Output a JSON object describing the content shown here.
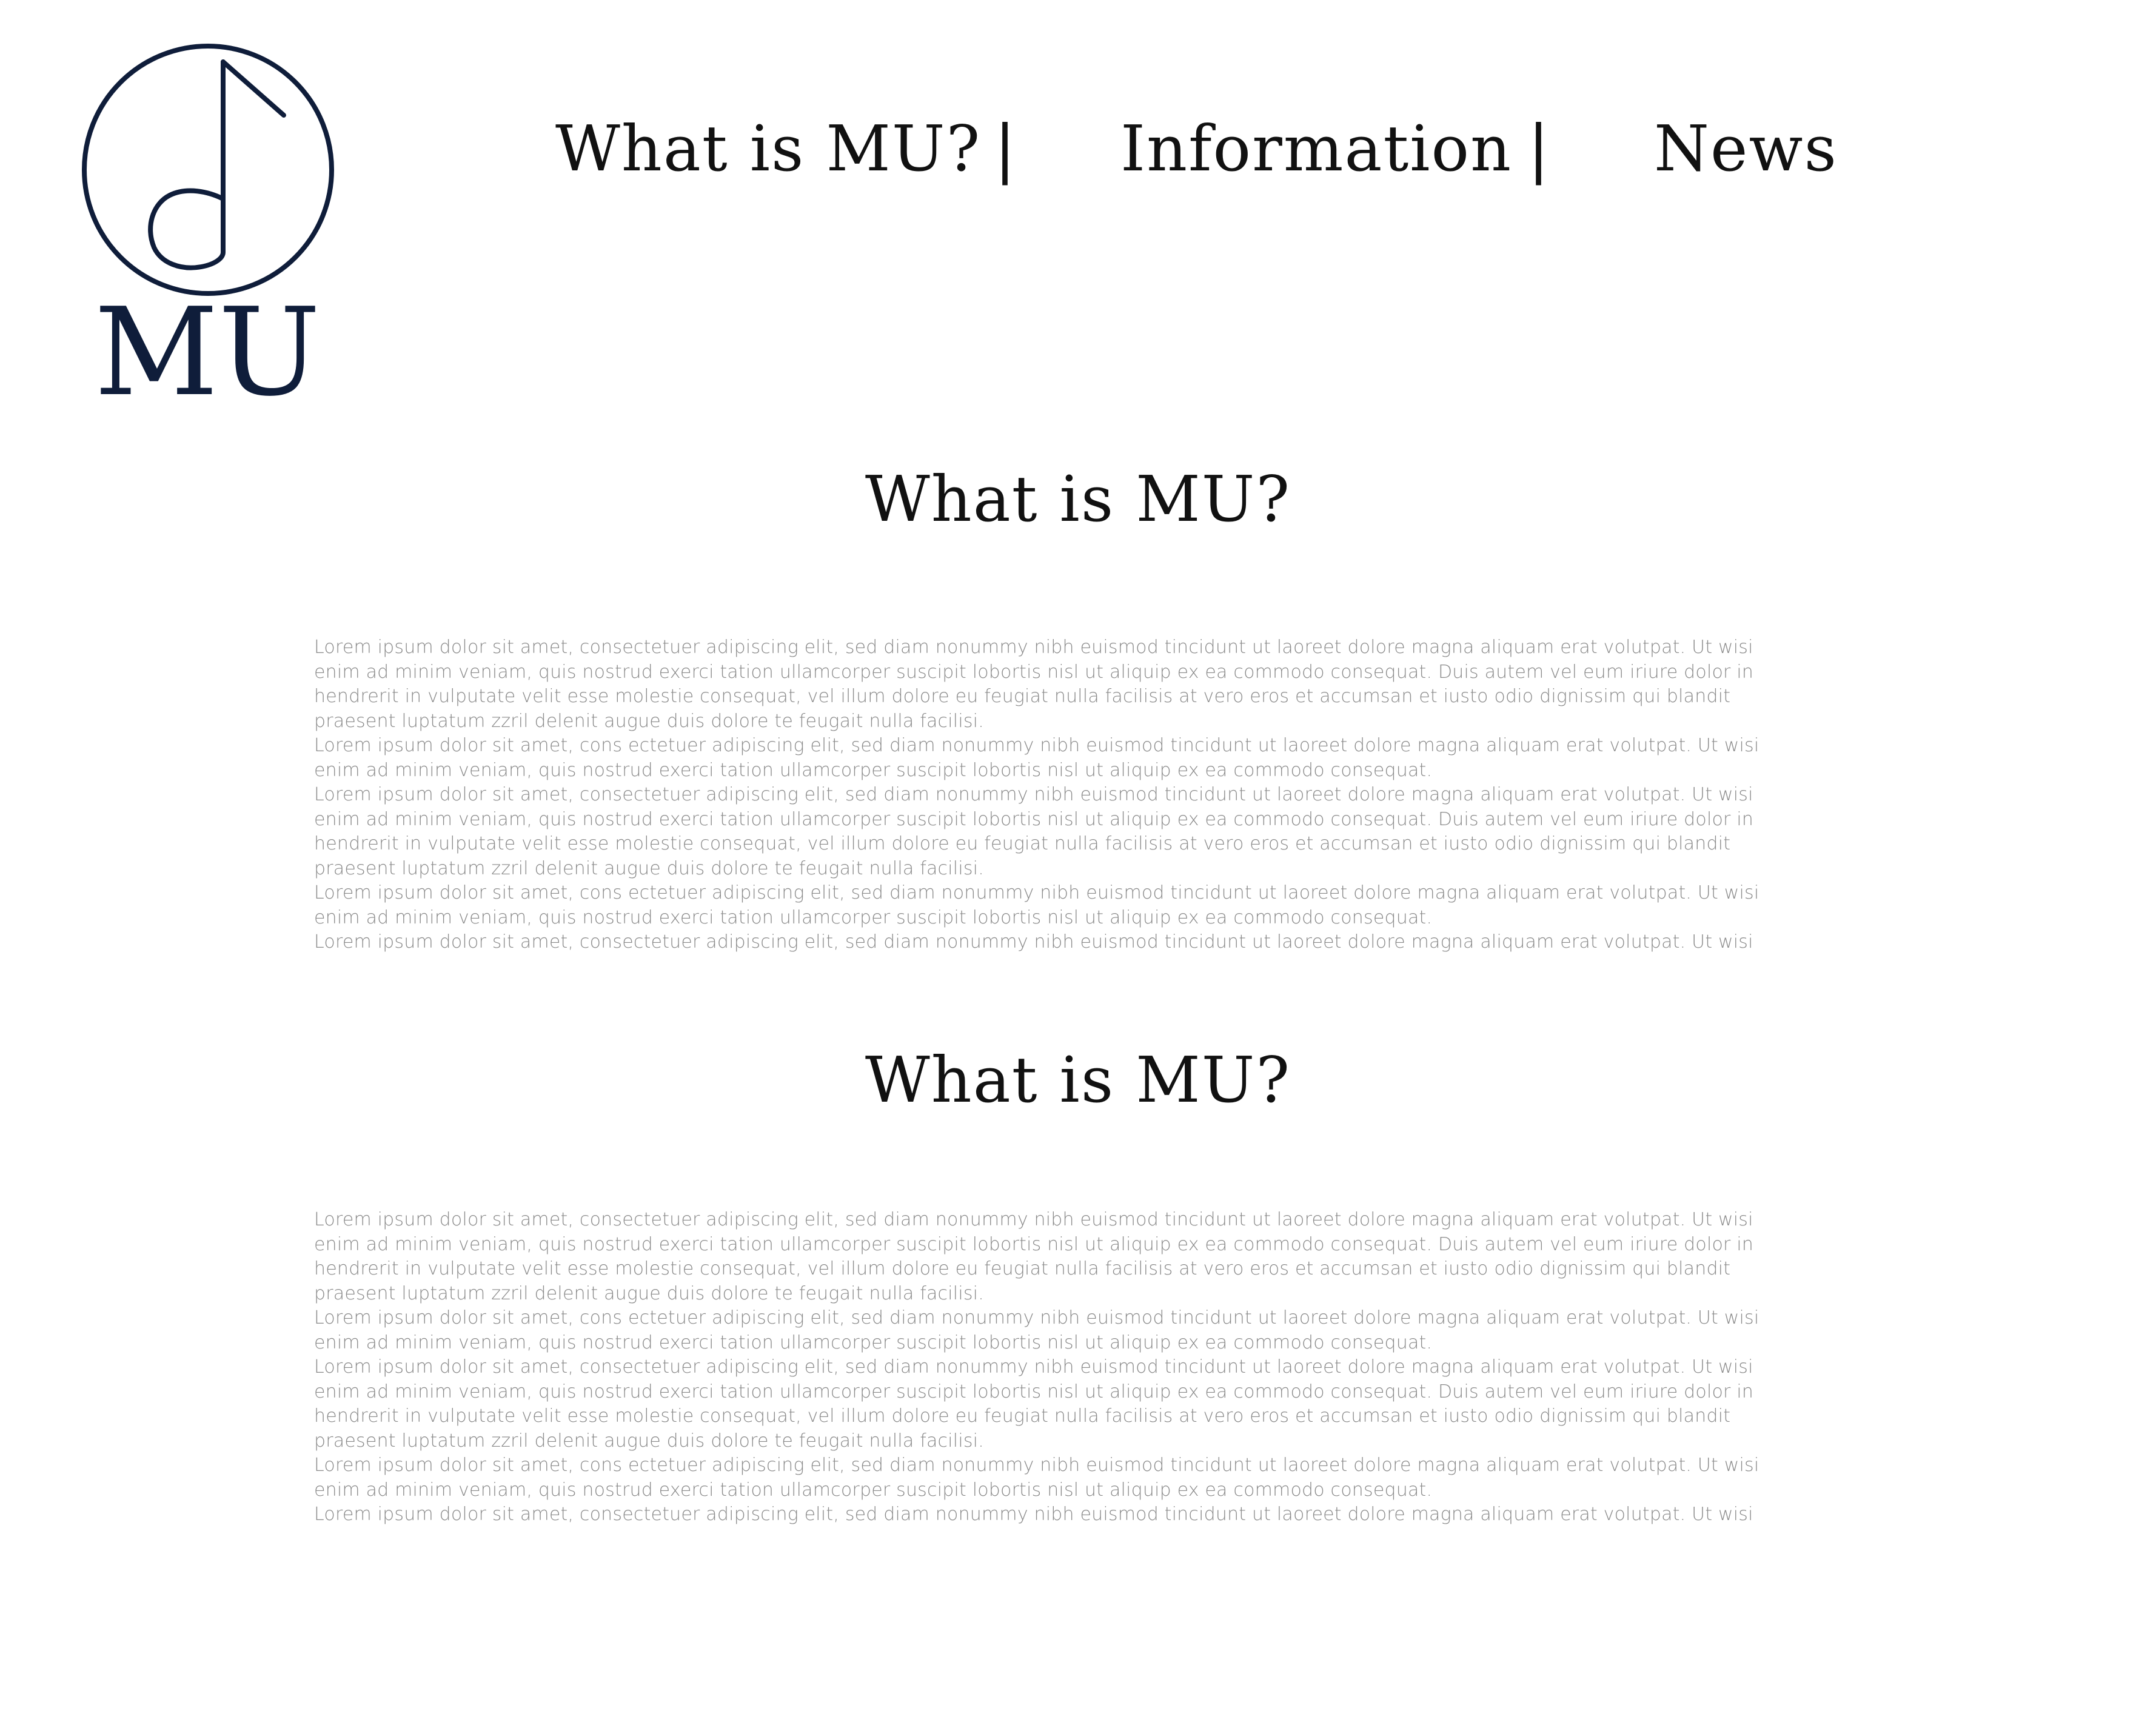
{
  "brand": {
    "logo_text": "MU",
    "logo_icon": "music-note-in-circle-icon",
    "color": "#0f1d3a"
  },
  "nav": {
    "items": [
      {
        "label": "What is MU?"
      },
      {
        "label": "Information"
      },
      {
        "label": "News"
      }
    ],
    "separator": "|"
  },
  "sections": [
    {
      "title": "What is MU?",
      "paragraphs": [
        "Lorem ipsum dolor sit amet, consectetuer adipiscing elit, sed diam nonummy nibh euismod tincidunt ut laoreet dolore magna aliquam erat volutpat. Ut wisi enim ad minim veniam, quis nostrud exerci tation ullamcorper suscipit lobortis nisl ut aliquip ex ea commodo consequat. Duis autem vel eum iriure dolor in hendrerit in vulputate velit esse molestie consequat, vel illum dolore eu feugiat nulla facilisis at vero eros et accumsan et iusto odio dignissim qui blandit praesent luptatum zzril delenit augue duis dolore te feugait nulla facilisi.",
        "Lorem ipsum dolor sit amet, cons ectetuer adipiscing elit, sed diam nonummy nibh euismod tincidunt ut laoreet dolore magna aliquam erat volutpat. Ut wisi enim ad minim veniam, quis nostrud exerci tation ullamcorper suscipit lobortis nisl ut aliquip ex ea commodo consequat.",
        "Lorem ipsum dolor sit amet, consectetuer adipiscing elit, sed diam nonummy nibh euismod tincidunt ut laoreet dolore magna aliquam erat volutpat. Ut wisi enim ad minim veniam, quis nostrud exerci tation ullamcorper suscipit lobortis nisl ut aliquip ex ea commodo consequat. Duis autem vel eum iriure dolor in hendrerit in vulputate velit esse molestie consequat, vel illum dolore eu feugiat nulla facilisis at vero eros et accumsan et iusto odio dignissim qui blandit praesent luptatum zzril delenit augue duis dolore te feugait nulla facilisi.",
        "Lorem ipsum dolor sit amet, cons ectetuer adipiscing elit, sed diam nonummy nibh euismod tincidunt ut laoreet dolore magna aliquam erat volutpat. Ut wisi enim ad minim veniam, quis nostrud exerci tation ullamcorper suscipit lobortis nisl ut aliquip ex ea commodo consequat.",
        "Lorem ipsum dolor sit amet, consectetuer adipiscing elit, sed diam nonummy nibh euismod tincidunt ut laoreet dolore magna aliquam erat volutpat. Ut wisi"
      ]
    },
    {
      "title": "What is MU?",
      "paragraphs": [
        "Lorem ipsum dolor sit amet, consectetuer adipiscing elit, sed diam nonummy nibh euismod tincidunt ut laoreet dolore magna aliquam erat volutpat. Ut wisi enim ad minim veniam, quis nostrud exerci tation ullamcorper suscipit lobortis nisl ut aliquip ex ea commodo consequat. Duis autem vel eum iriure dolor in hendrerit in vulputate velit esse molestie consequat, vel illum dolore eu feugiat nulla facilisis at vero eros et accumsan et iusto odio dignissim qui blandit praesent luptatum zzril delenit augue duis dolore te feugait nulla facilisi.",
        "Lorem ipsum dolor sit amet, cons ectetuer adipiscing elit, sed diam nonummy nibh euismod tincidunt ut laoreet dolore magna aliquam erat volutpat. Ut wisi enim ad minim veniam, quis nostrud exerci tation ullamcorper suscipit lobortis nisl ut aliquip ex ea commodo consequat.",
        "Lorem ipsum dolor sit amet, consectetuer adipiscing elit, sed diam nonummy nibh euismod tincidunt ut laoreet dolore magna aliquam erat volutpat. Ut wisi enim ad minim veniam, quis nostrud exerci tation ullamcorper suscipit lobortis nisl ut aliquip ex ea commodo consequat. Duis autem vel eum iriure dolor in hendrerit in vulputate velit esse molestie consequat, vel illum dolore eu feugiat nulla facilisis at vero eros et accumsan et iusto odio dignissim qui blandit praesent luptatum zzril delenit augue duis dolore te feugait nulla facilisi.",
        "Lorem ipsum dolor sit amet, cons ectetuer adipiscing elit, sed diam nonummy nibh euismod tincidunt ut laoreet dolore magna aliquam erat volutpat. Ut wisi enim ad minim veniam, quis nostrud exerci tation ullamcorper suscipit lobortis nisl ut aliquip ex ea commodo consequat.",
        "Lorem ipsum dolor sit amet, consectetuer adipiscing elit, sed diam nonummy nibh euismod tincidunt ut laoreet dolore magna aliquam erat volutpat. Ut wisi"
      ]
    }
  ]
}
